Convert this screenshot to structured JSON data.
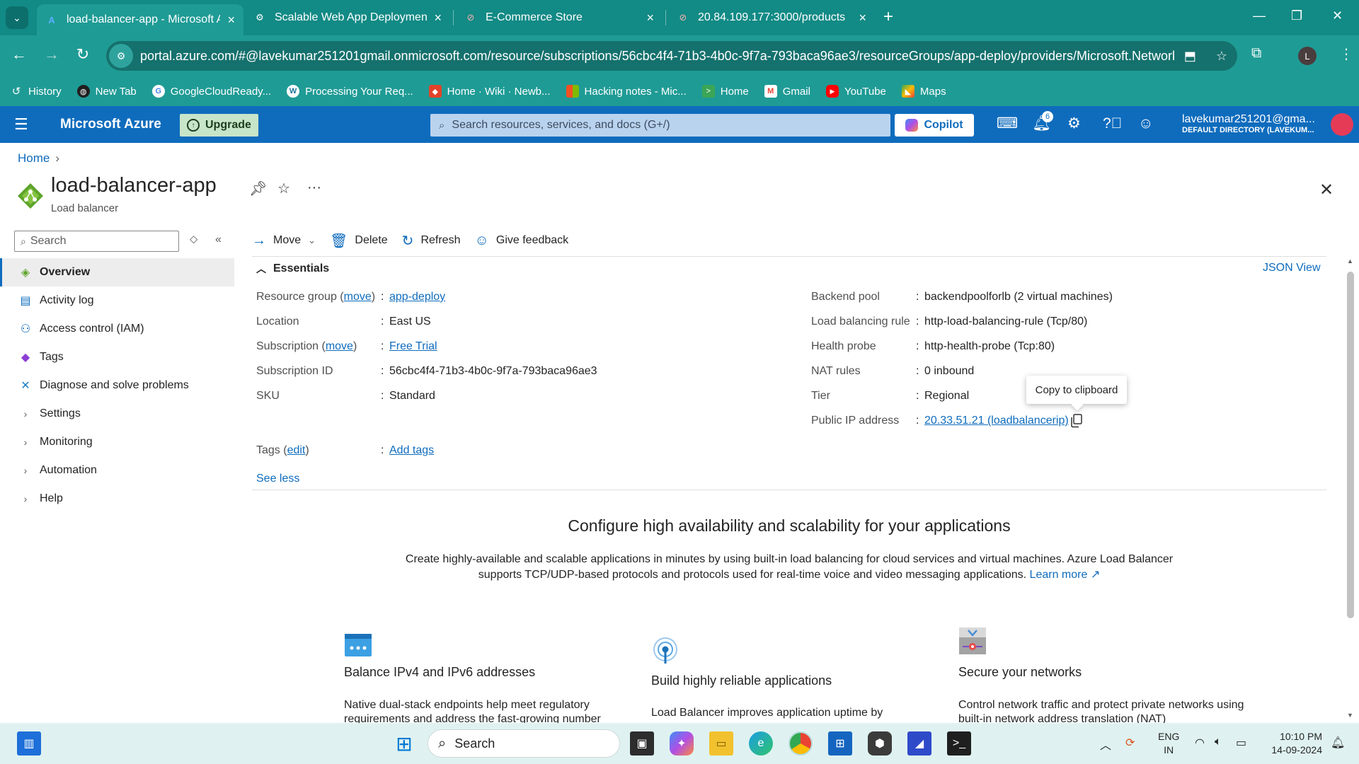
{
  "browser": {
    "tabs": [
      {
        "label": "load-balancer-app - Microsoft Azure",
        "active": true
      },
      {
        "label": "Scalable Web App Deployment",
        "active": false
      },
      {
        "label": "E-Commerce Store",
        "active": false
      },
      {
        "label": "20.84.109.177:3000/products",
        "active": false
      }
    ],
    "url": "portal.azure.com/#@lavekumar251201gmail.onmicrosoft.com/resource/subscriptions/56cbc4f4-71b3-4b0c-9f7a-793baca96ae3/resourceGroups/app-deploy/providers/Microsoft.Network/...",
    "profile_initial": "L",
    "bookmarks": [
      {
        "label": "History",
        "icon": "history-icon",
        "color": "#1f9b95"
      },
      {
        "label": "New Tab",
        "icon": "globe-icon",
        "color": "#1f1f1f"
      },
      {
        "label": "GoogleCloudReady...",
        "icon": "google-icon",
        "color": "#ffffff"
      },
      {
        "label": "Processing Your Req...",
        "icon": "wordpress-icon",
        "color": "#ffffff"
      },
      {
        "label": "Home · Wiki · Newb...",
        "icon": "gitlab-icon",
        "color": "#e2432a"
      },
      {
        "label": "Hacking notes - Mic...",
        "icon": "microsoft-icon",
        "color": "#f25022"
      },
      {
        "label": "Home",
        "icon": "terminal-icon",
        "color": "#3aa655"
      },
      {
        "label": "Gmail",
        "icon": "gmail-icon",
        "color": "#ea4335"
      },
      {
        "label": "YouTube",
        "icon": "youtube-icon",
        "color": "#ff0000"
      },
      {
        "label": "Maps",
        "icon": "maps-icon",
        "color": "#34a853"
      }
    ]
  },
  "azure": {
    "brand": "Microsoft Azure",
    "upgrade_label": "Upgrade",
    "search_placeholder": "Search resources, services, and docs (G+/)",
    "copilot_label": "Copilot",
    "notification_count": "6",
    "account_name": "lavekumar251201@gma...",
    "account_directory": "DEFAULT DIRECTORY (LAVEKUM..."
  },
  "page": {
    "breadcrumb": "Home",
    "title": "load-balancer-app",
    "subtitle": "Load balancer",
    "nav_search_placeholder": "Search",
    "nav": [
      {
        "label": "Overview",
        "icon": "overview-icon",
        "active": true,
        "expandable": false
      },
      {
        "label": "Activity log",
        "icon": "activity-log-icon",
        "active": false,
        "expandable": false
      },
      {
        "label": "Access control (IAM)",
        "icon": "iam-icon",
        "active": false,
        "expandable": false
      },
      {
        "label": "Tags",
        "icon": "tag-icon",
        "active": false,
        "expandable": false
      },
      {
        "label": "Diagnose and solve problems",
        "icon": "wrench-icon",
        "active": false,
        "expandable": false
      },
      {
        "label": "Settings",
        "icon": "chevron-right-icon",
        "active": false,
        "expandable": true
      },
      {
        "label": "Monitoring",
        "icon": "chevron-right-icon",
        "active": false,
        "expandable": true
      },
      {
        "label": "Automation",
        "icon": "chevron-right-icon",
        "active": false,
        "expandable": true
      },
      {
        "label": "Help",
        "icon": "chevron-right-icon",
        "active": false,
        "expandable": true
      }
    ],
    "commands": {
      "move": "Move",
      "delete": "Delete",
      "refresh": "Refresh",
      "feedback": "Give feedback"
    },
    "essentials": {
      "header": "Essentials",
      "json_view": "JSON View",
      "left": [
        {
          "label": "Resource group",
          "paren_link": "move",
          "value": "app-deploy",
          "value_is_link": true
        },
        {
          "label": "Location",
          "paren_link": "",
          "value": "East US",
          "value_is_link": false
        },
        {
          "label": "Subscription",
          "paren_link": "move",
          "value": "Free Trial",
          "value_is_link": true
        },
        {
          "label": "Subscription ID",
          "paren_link": "",
          "value": "56cbc4f4-71b3-4b0c-9f7a-793baca96ae3",
          "value_is_link": false
        },
        {
          "label": "SKU",
          "paren_link": "",
          "value": "Standard",
          "value_is_link": false
        }
      ],
      "right": [
        {
          "label": "Backend pool",
          "value": "backendpoolforlb (2 virtual machines)",
          "value_is_link": false
        },
        {
          "label": "Load balancing rule",
          "value": "http-load-balancing-rule (Tcp/80)",
          "value_is_link": false
        },
        {
          "label": "Health probe",
          "value": "http-health-probe (Tcp:80)",
          "value_is_link": false
        },
        {
          "label": "NAT rules",
          "value": "0 inbound",
          "value_is_link": false
        },
        {
          "label": "Tier",
          "value": "Regional",
          "value_is_link": false
        },
        {
          "label": "Public IP address",
          "value": "20.33.51.21 (loadbalancerip)",
          "value_is_link": true
        }
      ],
      "tags": {
        "label": "Tags",
        "paren_link": "edit",
        "value": "Add tags"
      },
      "tooltip": "Copy to clipboard",
      "see_less": "See less"
    },
    "promo": {
      "title": "Configure high availability and scalability for your applications",
      "description": "Create highly-available and scalable applications in minutes by using built-in load balancing for cloud services and virtual machines. Azure Load Balancer supports TCP/UDP-based protocols and protocols used for real-time voice and video messaging applications.",
      "learn_more": "Learn more",
      "features": [
        {
          "title": "Balance IPv4 and IPv6 addresses",
          "desc": "Native dual-stack endpoints help meet regulatory requirements and address the fast-growing number",
          "icon": "ip-address-icon"
        },
        {
          "title": "Build highly reliable applications",
          "desc": "Load Balancer improves application uptime by",
          "icon": "health-probe-icon"
        },
        {
          "title": "Secure your networks",
          "desc": "Control network traffic and protect private networks using built-in network address translation (NAT)",
          "icon": "network-security-icon"
        }
      ]
    }
  },
  "taskbar": {
    "search_label": "Search",
    "lang_line1": "ENG",
    "lang_line2": "IN",
    "time": "10:10 PM",
    "date": "14-09-2024"
  }
}
